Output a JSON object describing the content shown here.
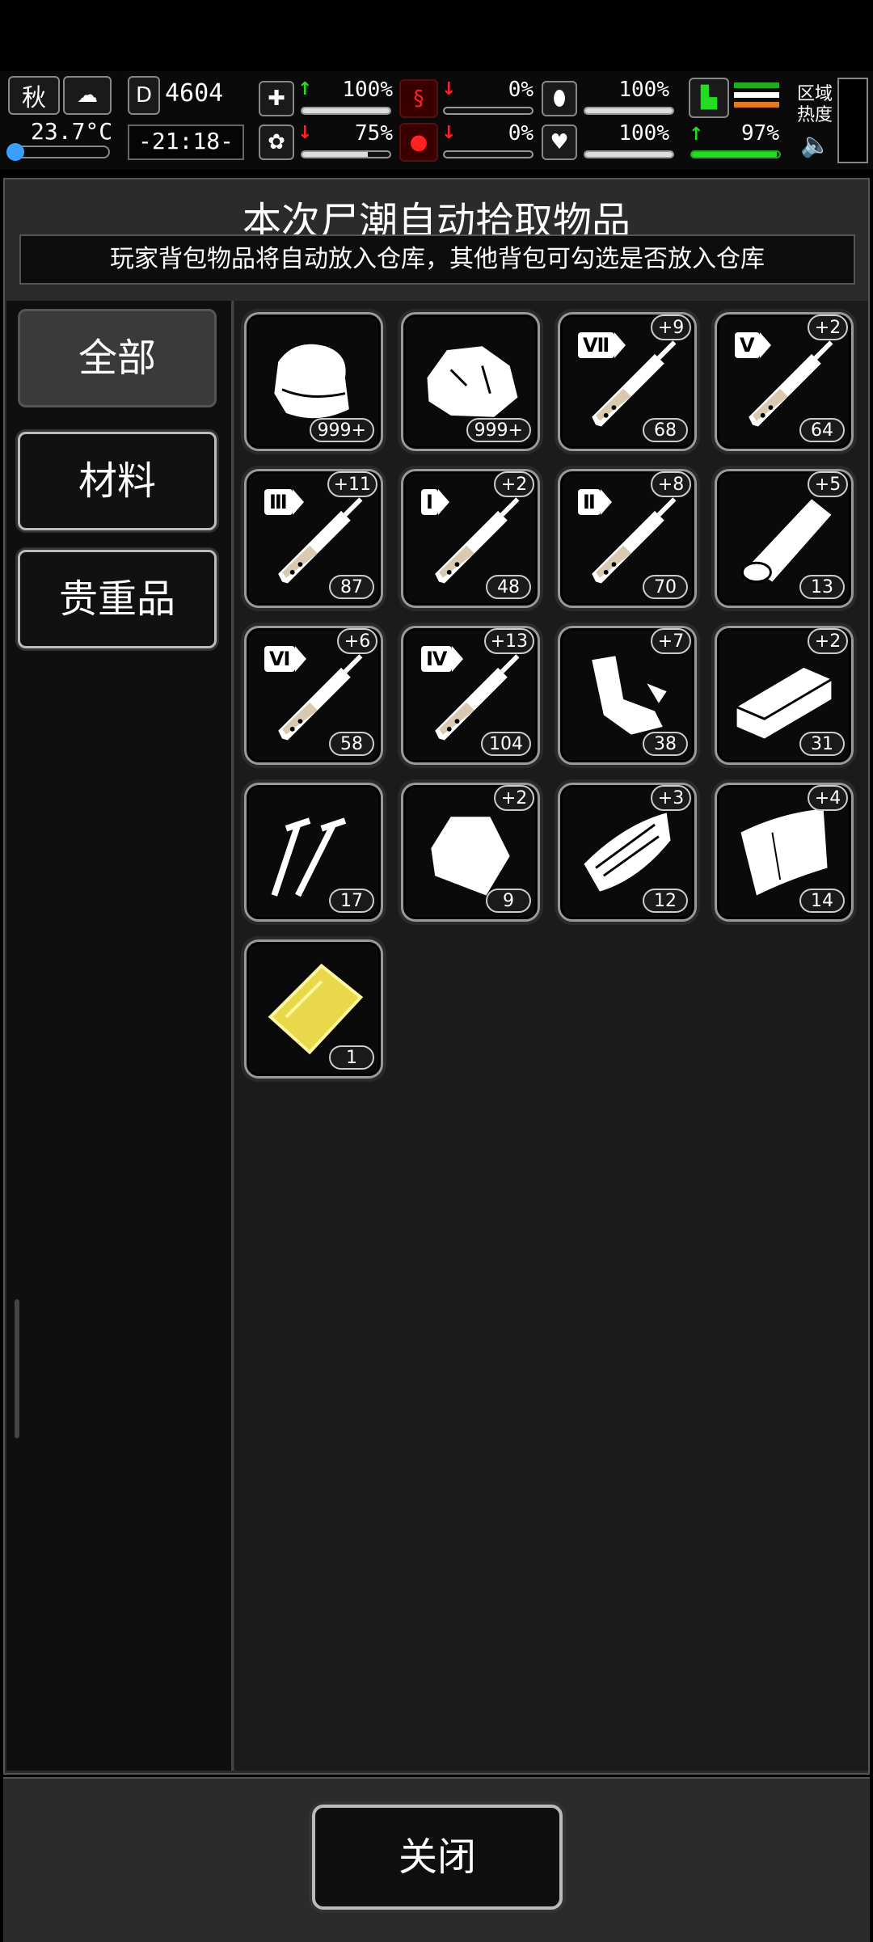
{
  "hud": {
    "season": "秋",
    "temperature": "23.7°C",
    "day_counter": "4604",
    "day_label": "D",
    "clock": "-21:18-",
    "stats": [
      {
        "name": "health",
        "icon": "medkit-icon",
        "trend": "up",
        "value": "100%",
        "level": 1.0
      },
      {
        "name": "hunger",
        "icon": "stomach-icon",
        "trend": "down",
        "value": "0%",
        "level": 0.0
      },
      {
        "name": "medicine",
        "icon": "pill-icon",
        "trend": "none",
        "value": "100%",
        "level": 1.0
      },
      {
        "name": "sanity",
        "icon": "brain-icon",
        "trend": "down",
        "value": "75%",
        "level": 0.75
      },
      {
        "name": "thirst",
        "icon": "blood-drop-icon",
        "trend": "down",
        "value": "0%",
        "level": 0.0
      },
      {
        "name": "heart",
        "icon": "heart-icon",
        "trend": "none",
        "value": "100%",
        "level": 1.0
      }
    ],
    "stamina": {
      "value": "97%",
      "level": 0.97,
      "trend": "up"
    },
    "zone_label_1": "区域",
    "zone_label_2": "热度"
  },
  "dialog": {
    "title": "本次尸潮自动拾取物品",
    "subtitle": "玩家背包物品将自动放入仓库，其他背包可勾选是否放入仓库"
  },
  "categories": [
    {
      "label": "全部",
      "active": true
    },
    {
      "label": "材料",
      "active": false
    },
    {
      "label": "贵重品",
      "active": false
    }
  ],
  "items": [
    {
      "icon": "cloth-icon",
      "count": "999+",
      "plus": ""
    },
    {
      "icon": "rock-icon",
      "count": "999+",
      "plus": ""
    },
    {
      "icon": "syringe-icon",
      "roman": "Ⅶ",
      "count": "68",
      "plus": "+9"
    },
    {
      "icon": "syringe-icon",
      "roman": "V",
      "count": "64",
      "plus": "+2"
    },
    {
      "icon": "syringe-icon",
      "roman": "Ⅲ",
      "count": "87",
      "plus": "+11"
    },
    {
      "icon": "syringe-icon",
      "roman": "I",
      "count": "48",
      "plus": "+2"
    },
    {
      "icon": "syringe-icon",
      "roman": "Ⅱ",
      "count": "70",
      "plus": "+8"
    },
    {
      "icon": "leather-roll-icon",
      "count": "13",
      "plus": "+5"
    },
    {
      "icon": "syringe-icon",
      "roman": "Ⅵ",
      "count": "58",
      "plus": "+6"
    },
    {
      "icon": "syringe-icon",
      "roman": "Ⅳ",
      "count": "104",
      "plus": "+13"
    },
    {
      "icon": "scrap-parts-icon",
      "count": "38",
      "plus": "+7"
    },
    {
      "icon": "wood-plank-icon",
      "count": "31",
      "plus": "+2"
    },
    {
      "icon": "nails-icon",
      "count": "17",
      "plus": ""
    },
    {
      "icon": "pouch-icon",
      "count": "9",
      "plus": "+2"
    },
    {
      "icon": "bark-icon",
      "count": "12",
      "plus": "+3"
    },
    {
      "icon": "cloth-sheet-icon",
      "count": "14",
      "plus": "+4"
    },
    {
      "icon": "gold-card-icon",
      "count": "1",
      "plus": ""
    }
  ],
  "footer": {
    "close_label": "关闭"
  },
  "colors": {
    "accent_green": "#22dd22",
    "alert_red": "#ff2222",
    "gold": "#e8d84a"
  }
}
